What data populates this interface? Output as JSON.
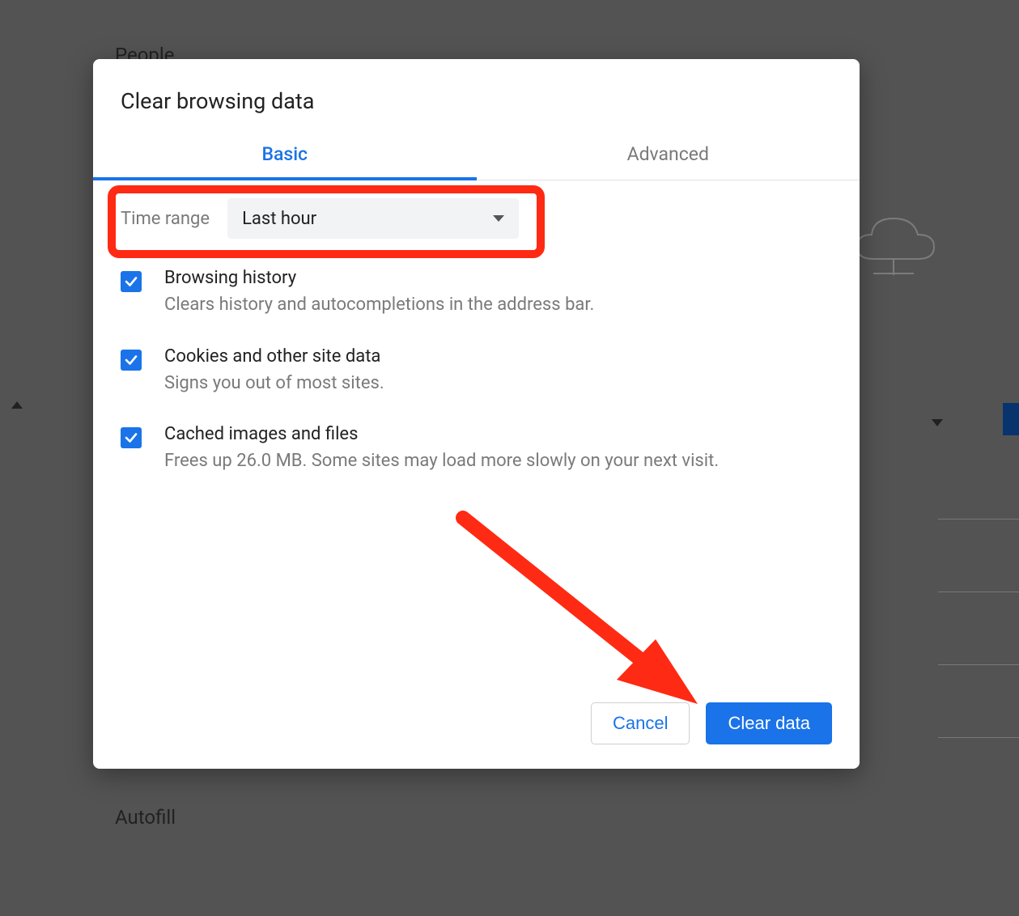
{
  "background": {
    "people_heading": "People",
    "autofill_heading": "Autofill"
  },
  "modal": {
    "title": "Clear browsing data",
    "tabs": {
      "basic": "Basic",
      "advanced": "Advanced"
    },
    "time_range": {
      "label": "Time range",
      "selected": "Last hour"
    },
    "options": [
      {
        "title": "Browsing history",
        "desc": "Clears history and autocompletions in the address bar.",
        "checked": true
      },
      {
        "title": "Cookies and other site data",
        "desc": "Signs you out of most sites.",
        "checked": true
      },
      {
        "title": "Cached images and files",
        "desc": "Frees up 26.0 MB. Some sites may load more slowly on your next visit.",
        "checked": true
      }
    ],
    "buttons": {
      "cancel": "Cancel",
      "clear": "Clear data"
    }
  },
  "annotations": {
    "highlight_color": "#ff2a13",
    "arrow_color": "#ff2a13"
  }
}
